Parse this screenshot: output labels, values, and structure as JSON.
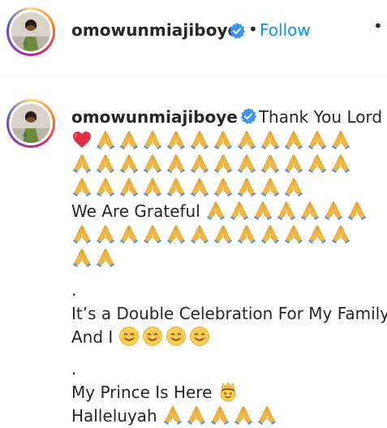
{
  "post": {
    "username": "omowunmiajiboye",
    "follow_label": "Follow",
    "separator": "•",
    "more_label": "••"
  },
  "caption": {
    "username": "omowunmiajiboye",
    "intro": "Thank You Lord",
    "lines": [
      {
        "text": "",
        "emojis": [
          "heart",
          "pray",
          "pray",
          "pray",
          "pray",
          "pray",
          "pray",
          "pray",
          "pray",
          "pray",
          "pray",
          "pray"
        ]
      },
      {
        "text": "",
        "emojis": [
          "pray",
          "pray",
          "pray",
          "pray",
          "pray",
          "pray",
          "pray",
          "pray",
          "pray",
          "pray",
          "pray",
          "pray"
        ]
      },
      {
        "text": "",
        "emojis": [
          "pray",
          "pray",
          "pray",
          "pray",
          "pray",
          "pray",
          "pray",
          "pray",
          "pray",
          "pray"
        ]
      },
      {
        "text": "We Are Grateful",
        "emojis": [
          "pray",
          "pray",
          "pray",
          "pray",
          "pray",
          "pray",
          "pray"
        ]
      },
      {
        "text": "",
        "emojis": [
          "pray",
          "pray",
          "pray",
          "pray",
          "pray",
          "pray",
          "pray",
          "pray",
          "pray",
          "pray",
          "pray",
          "pray"
        ]
      },
      {
        "text": "",
        "emojis": [
          "pray",
          "pray"
        ]
      },
      {
        "text": "",
        "emojis": [],
        "gap": true
      },
      {
        "text": ".",
        "emojis": []
      },
      {
        "text": "It’s a Double Celebration For My Family",
        "emojis": []
      },
      {
        "text": "And I",
        "emojis": [
          "smile",
          "smile",
          "smile",
          "smile"
        ]
      },
      {
        "text": "",
        "emojis": [],
        "gap": true
      },
      {
        "text": ".",
        "emojis": []
      },
      {
        "text": "My Prince Is Here",
        "emojis": [
          "prince"
        ]
      },
      {
        "text": "Halleluyah",
        "emojis": [
          "pray",
          "pray",
          "pray",
          "pray",
          "pray"
        ]
      }
    ]
  },
  "colors": {
    "link_blue": "#0095f6",
    "verified_blue": "#3897f0",
    "pray_color": "#f5b83d",
    "heart_color": "#dd2e44"
  }
}
